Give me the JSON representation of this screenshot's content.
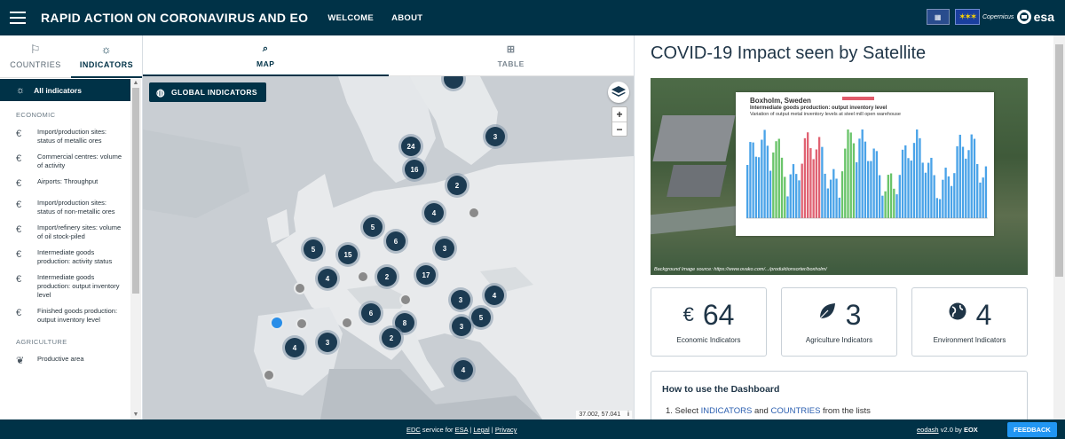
{
  "header": {
    "app_title": "RAPID ACTION ON CORONAVIRUS AND EO",
    "nav": [
      "WELCOME",
      "ABOUT"
    ],
    "logos": [
      "flag",
      "eu",
      "copernicus",
      "esa"
    ],
    "esa_label": "esa",
    "copernicus_label": "Copernicus"
  },
  "sidebar": {
    "tabs": [
      {
        "label": "COUNTRIES",
        "icon": "flag-icon"
      },
      {
        "label": "INDICATORS",
        "icon": "lightbulb-icon",
        "active": true
      }
    ],
    "all_indicators": "All indicators",
    "sections": [
      {
        "heading": "ECONOMIC",
        "items": [
          "Import/production sites: status of metallic ores",
          "Commercial centres: volume of activity",
          "Airports: Throughput",
          "Import/production sites: status of non-metallic ores",
          "Import/refinery sites: volume of oil stock-piled",
          "Intermediate goods production: activity status",
          "Intermediate goods production: output inventory level",
          "Finished goods production: output inventory level"
        ],
        "icon": "euro-icon"
      },
      {
        "heading": "AGRICULTURE",
        "items": [
          "Productive area"
        ],
        "icon": "leaf-icon"
      }
    ]
  },
  "views": {
    "tabs": [
      {
        "label": "MAP",
        "icon": "map-search-icon",
        "active": true
      },
      {
        "label": "TABLE",
        "icon": "table-search-icon"
      }
    ]
  },
  "map": {
    "global_button": "GLOBAL INDICATORS",
    "zoom_in": "+",
    "zoom_out": "−",
    "coords": "37.002, 57.041",
    "info": "i",
    "clusters": [
      "24",
      "16",
      "3",
      "2",
      "4",
      "5",
      "6",
      "3",
      "5",
      "15",
      "4",
      "2",
      "17",
      "3",
      "4",
      "6",
      "8",
      "5",
      "3",
      "2",
      "3",
      "4",
      "4"
    ]
  },
  "panel": {
    "title": "COVID-19 Impact seen by Satellite",
    "image": {
      "chart_title": "Boxholm, Sweden",
      "chart_subtitle": "Intermediate goods production: output inventory level",
      "chart_desc": "Variation of output metal inventory levels at steel mill open warehouse",
      "caption": "Background Image source: https://www.ovako.com/.../produktionsorter/boxholm/"
    },
    "stats": [
      {
        "icon": "euro-icon",
        "symbol": "€",
        "value": "64",
        "label": "Economic Indicators"
      },
      {
        "icon": "leaf-icon",
        "symbol": "",
        "value": "3",
        "label": "Agriculture Indicators"
      },
      {
        "icon": "globe-icon",
        "symbol": "",
        "value": "4",
        "label": "Environment Indicators"
      }
    ],
    "howto": {
      "title": "How to use the Dashboard",
      "step_prefix": "1. Select ",
      "step_hl1": "INDICATORS",
      "step_mid": " and ",
      "step_hl2": "COUNTRIES",
      "step_suffix": " from the lists"
    }
  },
  "footer": {
    "edc": "EDC",
    "service_for": " service for ",
    "esa": "ESA",
    "legal": "Legal",
    "privacy": "Privacy",
    "sep": " | ",
    "eodash": "eodash",
    "version": " v2.0 by ",
    "eox": "EOX",
    "feedback": "FEEDBACK"
  },
  "colors": {
    "primary": "#003247",
    "accent": "#2196f3",
    "cluster": "#1c3b52",
    "highlight": "#2b5fb0"
  }
}
